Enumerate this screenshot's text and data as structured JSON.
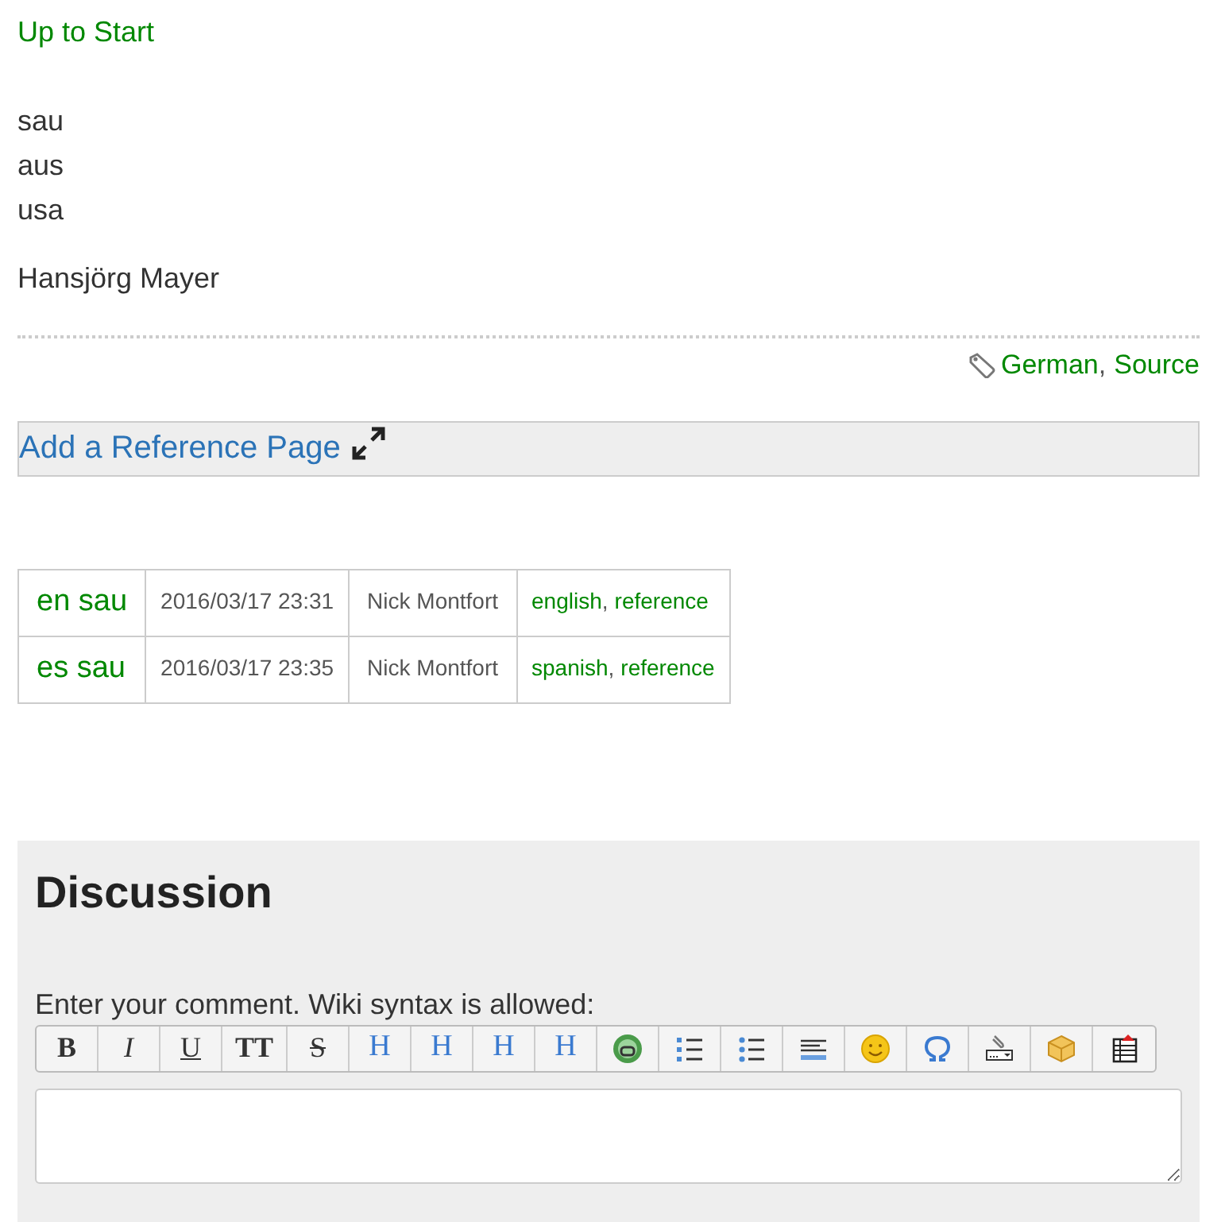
{
  "up_link": "Up to Start",
  "lines": [
    "sau",
    "aus",
    "usa"
  ],
  "author": "Hansjörg Mayer",
  "tags": {
    "items": [
      "German",
      "Source"
    ],
    "separator": ","
  },
  "reference_link": "Add a Reference Page",
  "pages": [
    {
      "title": "en sau",
      "date": "2016/03/17 23:31",
      "user": "Nick Montfort",
      "tags": [
        "english",
        "reference"
      ]
    },
    {
      "title": "es sau",
      "date": "2016/03/17 23:35",
      "user": "Nick Montfort",
      "tags": [
        "spanish",
        "reference"
      ]
    }
  ],
  "discussion": {
    "title": "Discussion",
    "label": "Enter your comment. Wiki syntax is allowed:",
    "toolbar": [
      {
        "kind": "text",
        "label": "B"
      },
      {
        "kind": "text",
        "label": "I"
      },
      {
        "kind": "text",
        "label": "U"
      },
      {
        "kind": "text",
        "label": "TT"
      },
      {
        "kind": "text",
        "label": "S"
      },
      {
        "kind": "heading",
        "label": "H"
      },
      {
        "kind": "heading",
        "label": "H"
      },
      {
        "kind": "heading",
        "label": "H"
      },
      {
        "kind": "heading",
        "label": "H"
      },
      {
        "kind": "icon"
      },
      {
        "kind": "icon"
      },
      {
        "kind": "icon"
      },
      {
        "kind": "icon"
      },
      {
        "kind": "icon"
      },
      {
        "kind": "icon"
      },
      {
        "kind": "icon"
      },
      {
        "kind": "icon"
      },
      {
        "kind": "icon"
      }
    ]
  }
}
